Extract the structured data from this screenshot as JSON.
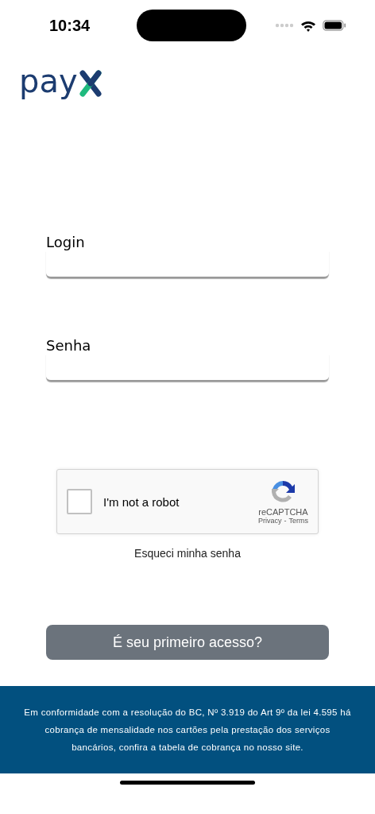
{
  "status_bar": {
    "time": "10:34"
  },
  "logo": {
    "text": "pay"
  },
  "fields": [
    {
      "label": "Login"
    },
    {
      "label": "Senha"
    }
  ],
  "captcha": {
    "checked": false,
    "label": "I'm not a robot",
    "brand": "reCAPTCHA",
    "privacy": "Privacy",
    "separator": "-",
    "terms": "Terms"
  },
  "forgot_link": "Esqueci minha senha",
  "first_access_button": "É seu primeiro acesso?",
  "footer": {
    "text": "Em conformidade com a resolução do BC, Nº 3.919 do Art 9º da lei 4.595 há cobrança de mensalidade nos cartões pela prestação dos serviços bancários, confira a tabela de cobrança no nosso site."
  }
}
